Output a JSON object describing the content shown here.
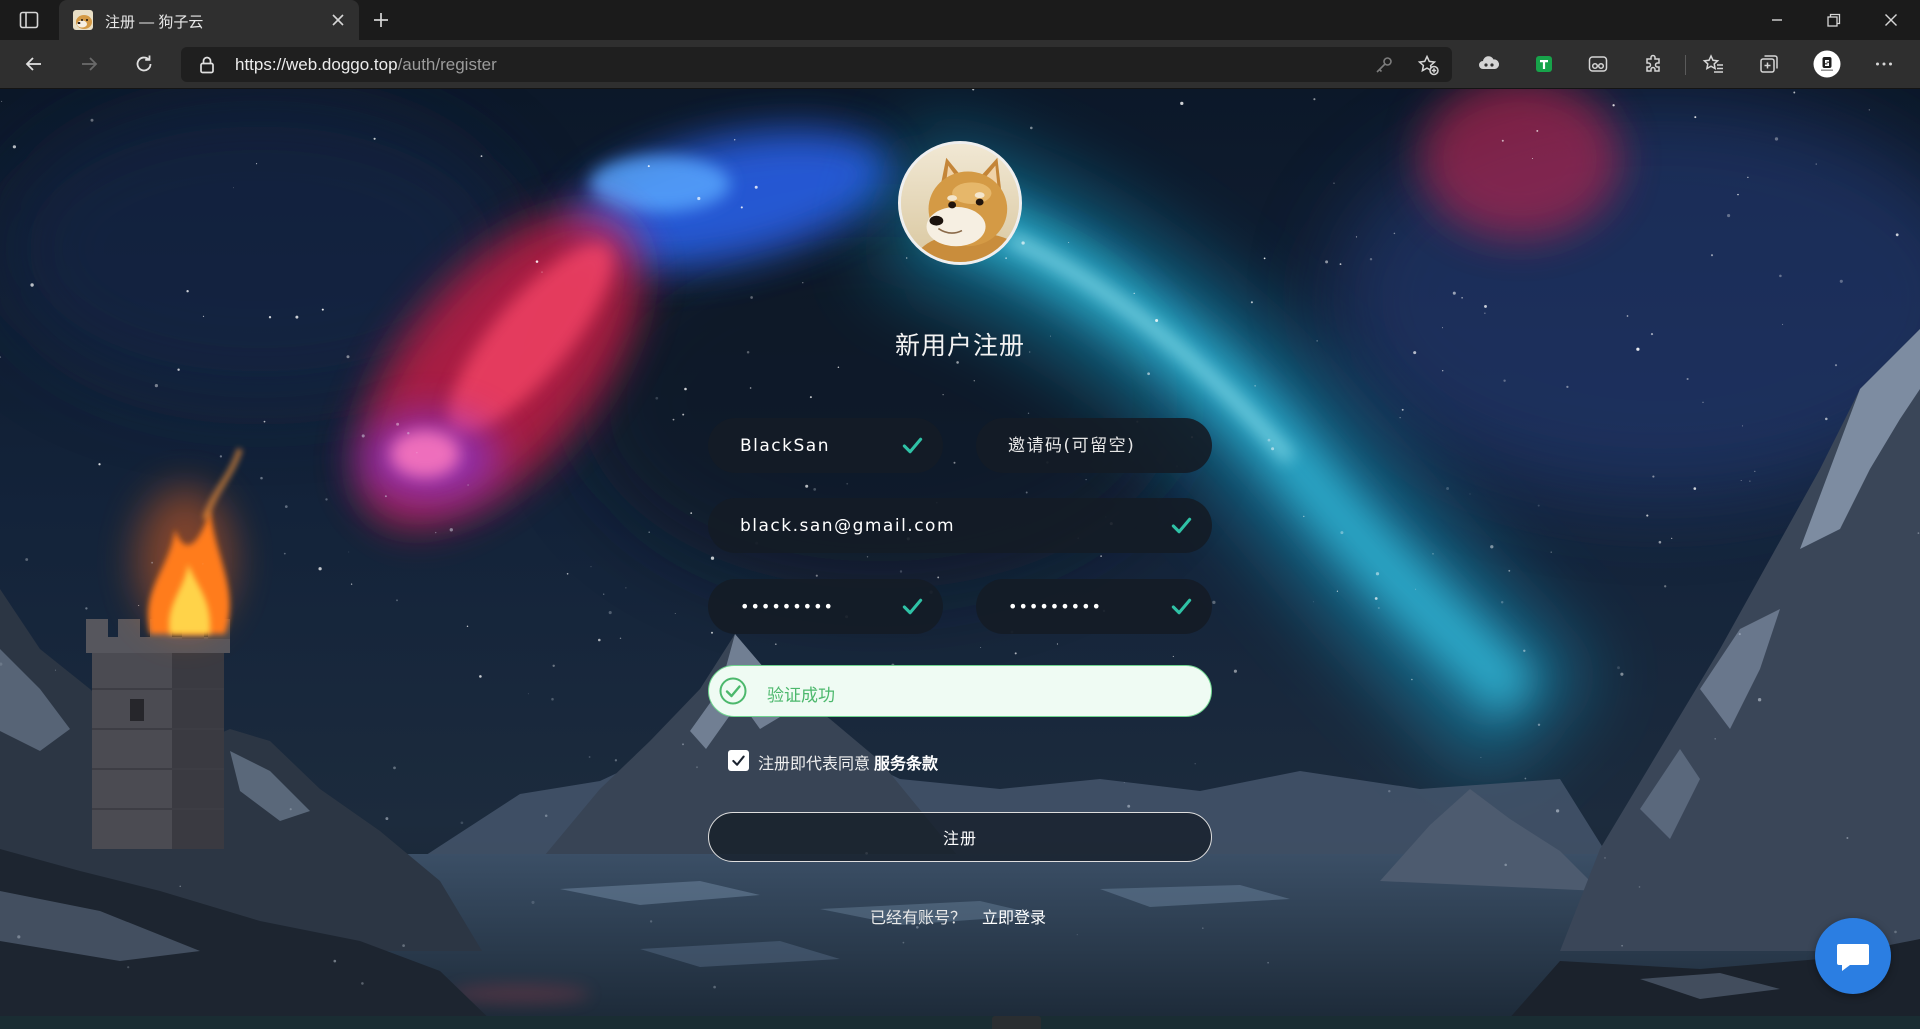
{
  "browser": {
    "tab": {
      "title": "注册 — 狗子云"
    },
    "address": {
      "host": "https://web.doggo.top",
      "path": "/auth/register"
    }
  },
  "register": {
    "title": "新用户注册",
    "username": {
      "value": "BlackSan",
      "valid": true
    },
    "invite_code": {
      "value": "",
      "placeholder": "邀请码(可留空)"
    },
    "email": {
      "value": "black.san@gmail.com",
      "valid": true
    },
    "password": {
      "value": "•••••••••",
      "valid": true
    },
    "password_confirm": {
      "value": "•••••••••",
      "valid": true
    },
    "captcha": {
      "status": "验证成功",
      "passed": true
    },
    "terms": {
      "checked": true,
      "text": "注册即代表同意",
      "link": "服务条款"
    },
    "submit": "注册",
    "login_prompt": {
      "text": "已经有账号？",
      "link": "立即登录"
    }
  },
  "colors": {
    "valid_check": "#2fc2a6",
    "captcha_success": "#4cb86c",
    "chat_button": "#2b7ee2",
    "extension_green": "#17a34a"
  },
  "icons": {
    "field_valid": "check-icon",
    "captcha": "check-circle-icon",
    "chat": "chat-bubble-icon",
    "avatar": "doge-avatar"
  }
}
